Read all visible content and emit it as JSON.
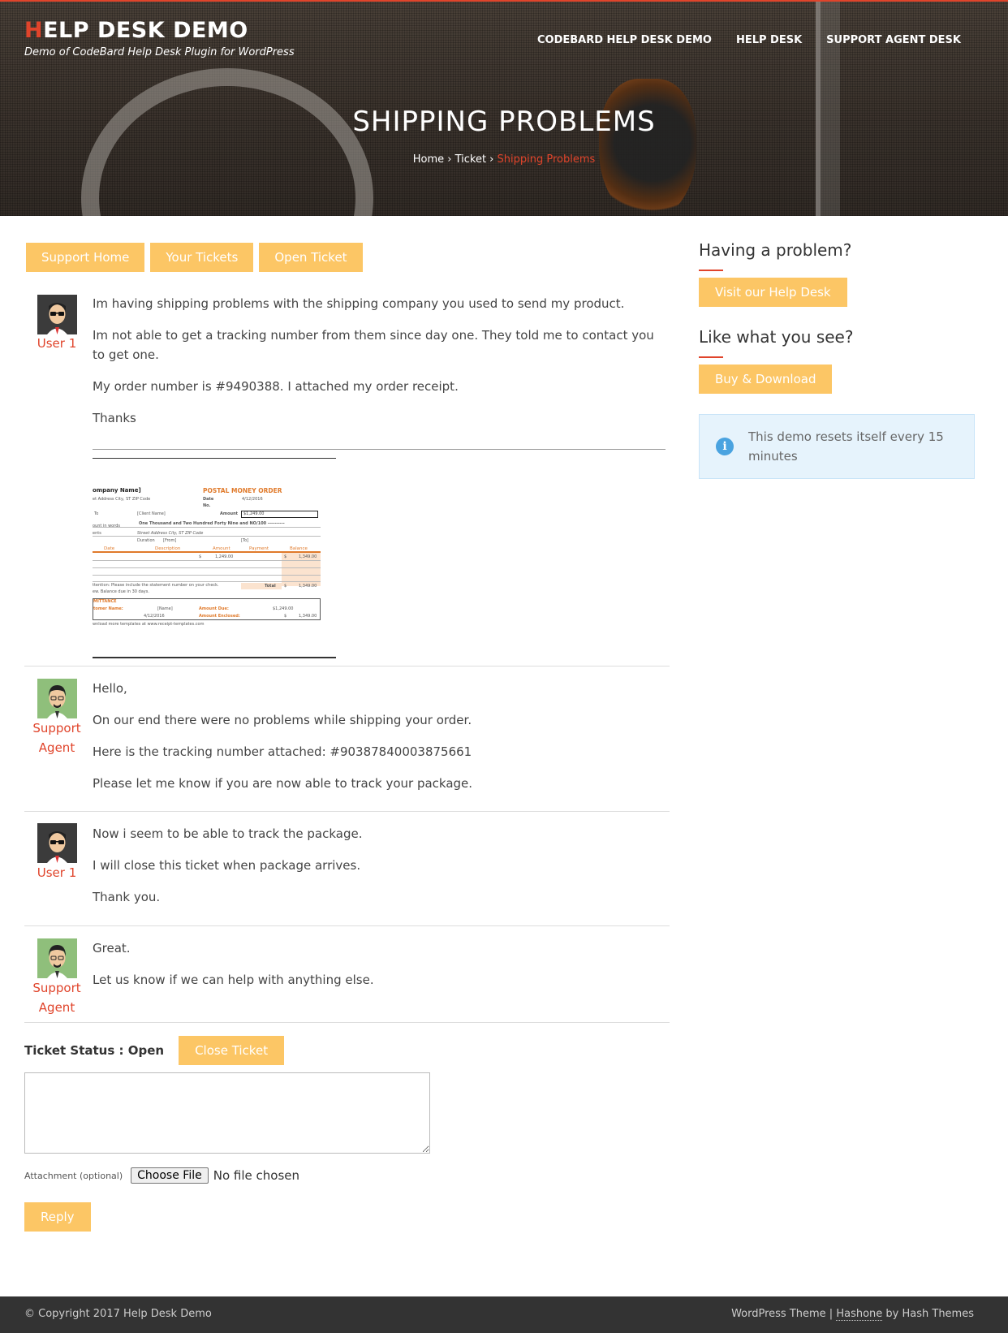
{
  "site": {
    "logo_first": "H",
    "logo_rest": "ELP DESK DEMO",
    "tagline": "Demo of CodeBard Help Desk Plugin for WordPress"
  },
  "nav": {
    "items": [
      "CODEBARD HELP DESK DEMO",
      "HELP DESK",
      "SUPPORT AGENT DESK"
    ]
  },
  "page": {
    "title": "SHIPPING PROBLEMS",
    "breadcrumb": {
      "home": "Home",
      "sep1": " › ",
      "ticket": "Ticket",
      "sep2": " › ",
      "current": "Shipping Problems"
    }
  },
  "top_buttons": [
    "Support Home",
    "Your Tickets",
    "Open Ticket"
  ],
  "messages": [
    {
      "author": "User 1",
      "paragraphs": [
        "Im having shipping problems with the shipping company you used to send my product.",
        "Im not able to get a tracking number from them since day one. They told me to contact you to get one.",
        "My order number is #9490388. I attached my order receipt.",
        "Thanks"
      ]
    },
    {
      "author_line1": "Support",
      "author_line2": "Agent",
      "paragraphs": [
        "Hello,",
        "On our end there were no problems while shipping your order.",
        "Here is the tracking number attached: #90387840003875661",
        "Please let me know if you are now able to track your package."
      ]
    },
    {
      "author": "User 1",
      "paragraphs": [
        "Now i seem to be able to track the package.",
        "I will close this ticket when package arrives.",
        "Thank you."
      ]
    },
    {
      "author_line1": "Support",
      "author_line2": "Agent",
      "paragraphs": [
        "Great.",
        "Let us know if we can help with anything else."
      ]
    }
  ],
  "receipt": {
    "company": "ompany Name]",
    "title": "POSTAL MONEY ORDER",
    "address": "et Address City, ST ZIP Code",
    "date_label": "Date",
    "date_value": "4/12/2016",
    "no_label": "No.",
    "to_label": "To",
    "client": "[Client Name]",
    "amount_label": "Amount",
    "amount_value": "$1,249.00",
    "words_label": "ount in words",
    "words_value": "One Thousand and Two Hundred Forty Nine and NO/100 ----------",
    "for_label": "ents",
    "street": "Street Address City, ST ZIP Code",
    "duration": "Duration",
    "from": "[From]",
    "to": "[To]",
    "cols": [
      "Date",
      "Description",
      "Amount",
      "Payment",
      "Balance"
    ],
    "row_dollar": "$",
    "row_amount": "1,249.00",
    "row_balance": "1,349.00",
    "note": "ttention: Please include the statement number on your check.",
    "due": "ew. Balance due in 30 days.",
    "total_label": "Total",
    "total_value": "1,349.00",
    "remit": "MITTANCE",
    "cust_label": "tomer Name:",
    "cust_value": "[Name]",
    "amount_due_label": "Amount Due:",
    "amount_due_value": "$1,249.00",
    "date2": "4/12/2016",
    "enclosed_label": "Amount Enclosed:",
    "enclosed_value": "1,349.00",
    "footer": "wnload more templates at www.receipt-templates.com"
  },
  "ticket": {
    "status_label": "Ticket Status : Open",
    "close_button": "Close Ticket",
    "attachment_label": "Attachment (optional)",
    "file_button": "Choose File",
    "file_none": "No file chosen",
    "reply_button": "Reply"
  },
  "sidebar": {
    "problem_heading": "Having a problem?",
    "problem_button": "Visit our Help Desk",
    "like_heading": "Like what you see?",
    "like_button": "Buy & Download",
    "notice_icon": "info-icon",
    "notice_text": "This demo resets itself every 15 minutes"
  },
  "footer": {
    "copyright": "© Copyright 2017 Help Desk Demo",
    "theme_prefix": "WordPress Theme | ",
    "theme_name": "Hashone",
    "theme_suffix": " by Hash Themes"
  },
  "colors": {
    "accent": "#e0442b",
    "button": "#fcc665",
    "notice_bg": "#e6f3fc",
    "footer_bg": "#333333"
  }
}
